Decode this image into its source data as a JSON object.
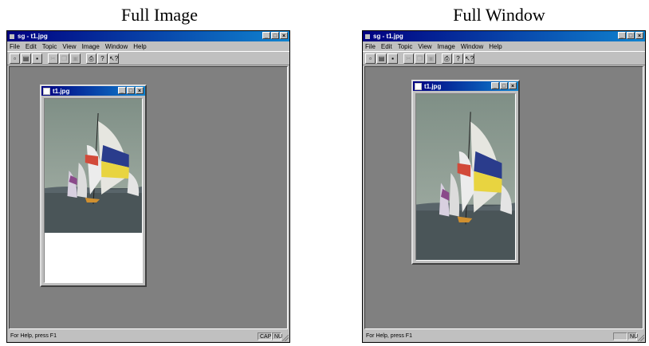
{
  "captions": {
    "left": "Full Image",
    "right": "Full Window"
  },
  "panes": [
    {
      "app_title": "sg - t1.jpg",
      "menu": [
        "File",
        "Edit",
        "Topic",
        "View",
        "Image",
        "Window",
        "Help"
      ],
      "window_buttons": [
        "_",
        "□",
        "×"
      ],
      "toolbar": [
        {
          "icon": "new-icon",
          "glyph": "▫",
          "enabled": true
        },
        {
          "icon": "open-icon",
          "glyph": "▤",
          "enabled": true
        },
        {
          "icon": "save-icon",
          "glyph": "▪",
          "enabled": true
        },
        {
          "icon": "cut-icon",
          "glyph": "✂",
          "enabled": false
        },
        {
          "icon": "copy-icon",
          "glyph": "❐",
          "enabled": false
        },
        {
          "icon": "paste-icon",
          "glyph": "▣",
          "enabled": false
        },
        {
          "icon": "print-icon",
          "glyph": "⎙",
          "enabled": true
        },
        {
          "icon": "help-icon",
          "glyph": "?",
          "enabled": true
        },
        {
          "icon": "context-help-icon",
          "glyph": "↖?",
          "enabled": true
        }
      ],
      "child_title": "t1.jpg",
      "status_text": "For Help, press F1",
      "status_panels": [
        "CAP",
        "NU"
      ]
    },
    {
      "app_title": "sg - t1.jpg",
      "menu": [
        "File",
        "Edit",
        "Topic",
        "View",
        "Image",
        "Window",
        "Help"
      ],
      "window_buttons": [
        "_",
        "□",
        "×"
      ],
      "toolbar": [
        {
          "icon": "new-icon",
          "glyph": "▫",
          "enabled": true
        },
        {
          "icon": "open-icon",
          "glyph": "▤",
          "enabled": true
        },
        {
          "icon": "save-icon",
          "glyph": "▪",
          "enabled": true
        },
        {
          "icon": "cut-icon",
          "glyph": "✂",
          "enabled": false
        },
        {
          "icon": "copy-icon",
          "glyph": "❐",
          "enabled": false
        },
        {
          "icon": "paste-icon",
          "glyph": "▣",
          "enabled": false
        },
        {
          "icon": "print-icon",
          "glyph": "⎙",
          "enabled": true
        },
        {
          "icon": "help-icon",
          "glyph": "?",
          "enabled": true
        },
        {
          "icon": "context-help-icon",
          "glyph": "↖?",
          "enabled": true
        }
      ],
      "child_title": "t1.jpg",
      "status_text": "For Help, press F1",
      "status_panels": [
        "",
        "NU"
      ]
    }
  ]
}
